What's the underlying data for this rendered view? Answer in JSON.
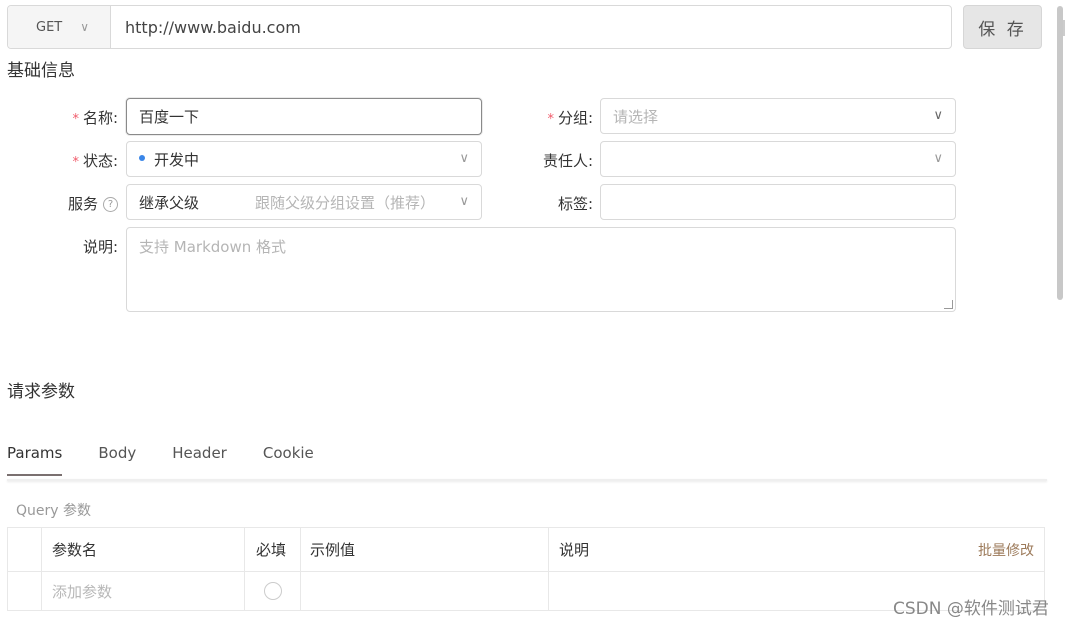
{
  "request": {
    "method": "GET",
    "url": "http://www.baidu.com",
    "save_label": "保 存"
  },
  "basic_info": {
    "title": "基础信息",
    "name_label": "名称:",
    "name_value": "百度一下",
    "group_label": "分组:",
    "group_placeholder": "请选择",
    "status_label": "状态:",
    "status_value": "开发中",
    "owner_label": "责任人:",
    "service_label": "服务",
    "service_value": "继承父级",
    "service_hint": "跟随父级分组设置（推荐）",
    "tags_label": "标签:",
    "desc_label": "说明:",
    "desc_placeholder": "支持 Markdown 格式"
  },
  "request_params": {
    "title": "请求参数",
    "tabs": [
      {
        "label": "Params",
        "active": true
      },
      {
        "label": "Body",
        "active": false
      },
      {
        "label": "Header",
        "active": false
      },
      {
        "label": "Cookie",
        "active": false
      }
    ],
    "query_label": "Query 参数",
    "table": {
      "headers": [
        "参数名",
        "必填",
        "示例值",
        "说明"
      ],
      "batch_edit": "批量修改",
      "add_placeholder": "添加参数"
    }
  },
  "watermark": "CSDN @软件测试君",
  "colors": {
    "required": "#f05a6a",
    "status_dot": "#3a86e8",
    "batch_link": "#9c7a5a"
  }
}
